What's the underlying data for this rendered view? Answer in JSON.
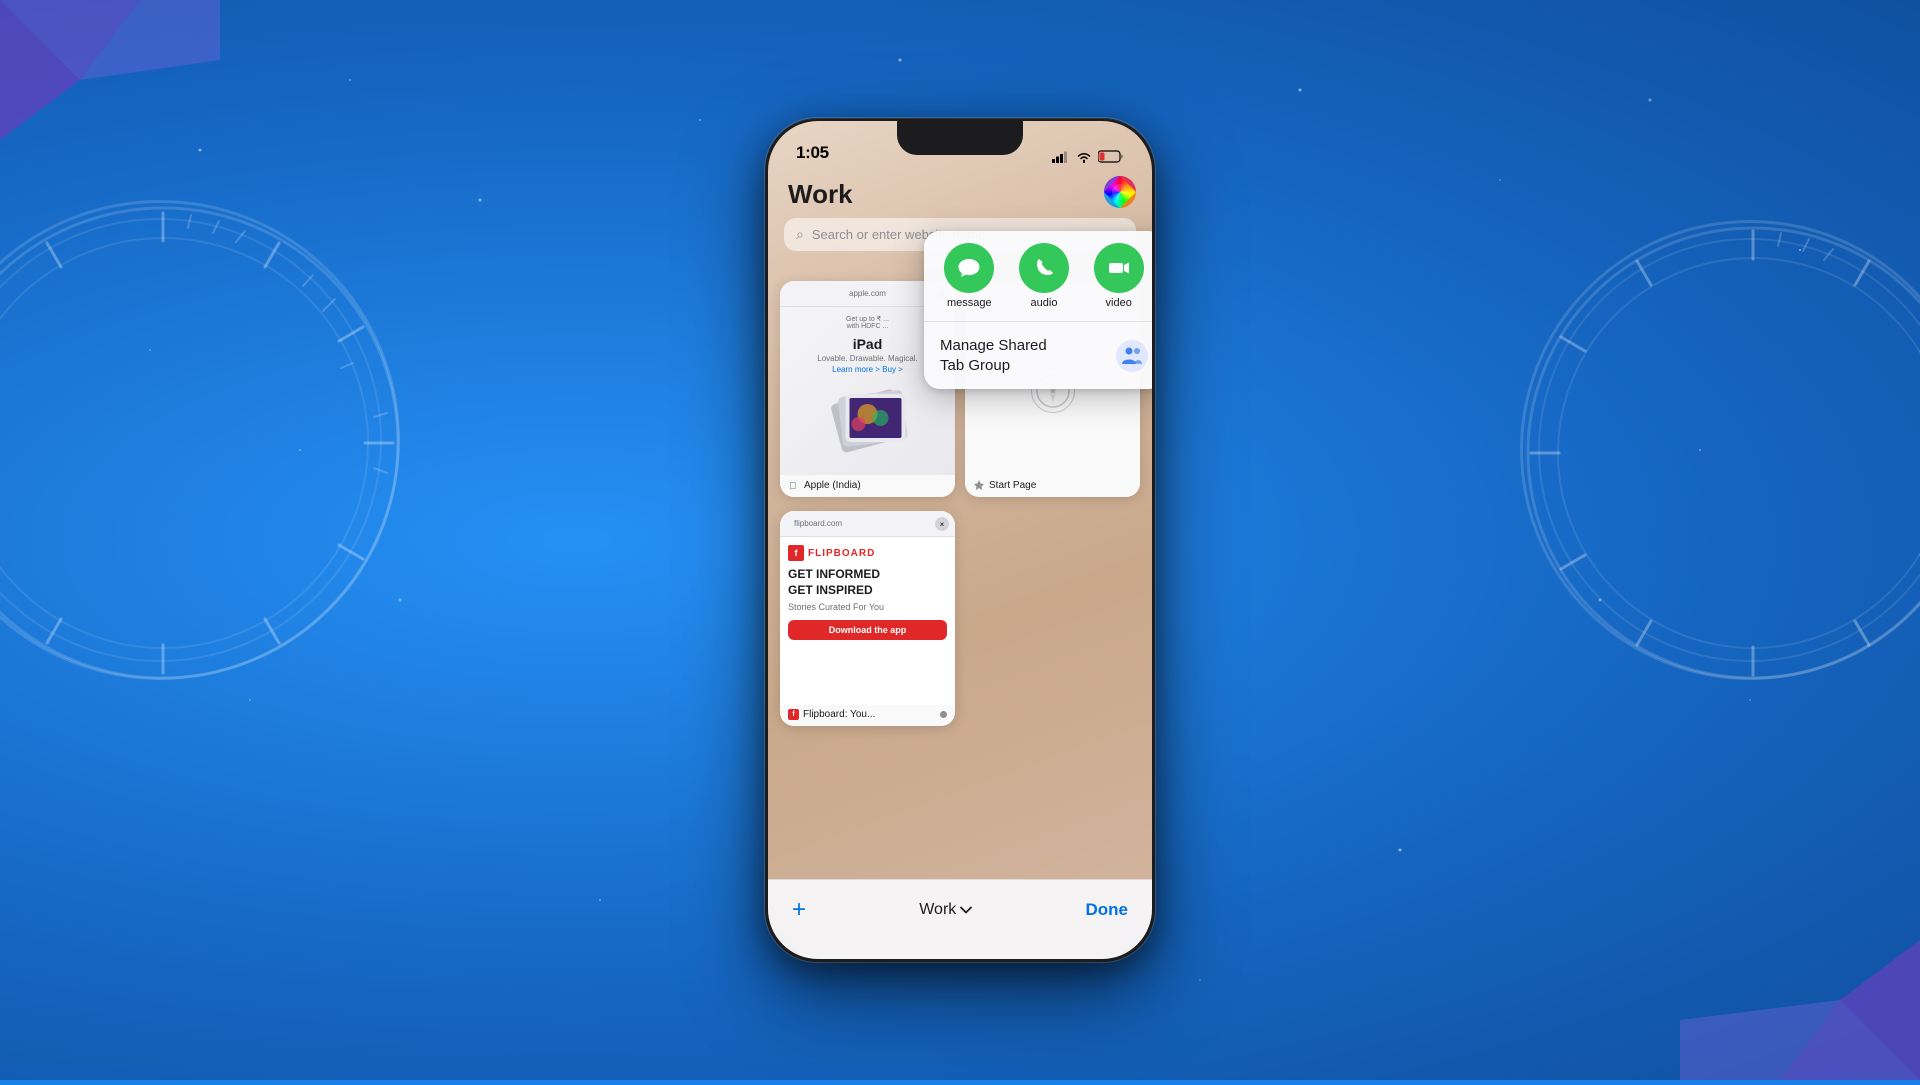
{
  "background": {
    "color": "#1a7fe8"
  },
  "status_bar": {
    "time": "1:05",
    "signal_bars": "●●●●",
    "wifi": "wifi",
    "battery": "battery"
  },
  "safari": {
    "tab_group": "Work",
    "search_placeholder": "Search or enter website name",
    "tabs": [
      {
        "id": "apple-india",
        "url": "apple.com",
        "title": "Apple (India)",
        "favicon": "apple",
        "type": "apple-ad",
        "ad_small": "Get up to ₹ ...\nwith HDFC ...",
        "ad_title": "iPad",
        "ad_subtitle": "Lovable. Drawable. Magical.",
        "ad_links": "Learn more >    Buy >"
      },
      {
        "id": "start-page",
        "url": "Start Page",
        "title": "Start Page",
        "favicon": "star",
        "type": "start-page"
      },
      {
        "id": "flipboard",
        "url": "flipboard.com",
        "title": "Flipboard: You...",
        "favicon": "flipboard",
        "type": "flipboard",
        "headline1": "GET INFORMED",
        "headline2": "GET INSPIRED",
        "subtitle": "Stories Curated For You",
        "btn_label": "Download the app"
      }
    ]
  },
  "popup": {
    "share_options": [
      {
        "id": "message",
        "label": "message",
        "icon": "💬"
      },
      {
        "id": "audio",
        "label": "audio",
        "icon": "📞"
      },
      {
        "id": "video",
        "label": "video",
        "icon": "🎥"
      }
    ],
    "manage_label": "Manage Shared\nTab Group",
    "manage_icon": "👥"
  },
  "toolbar": {
    "plus_label": "+",
    "tab_group_name": "Work",
    "chevron": "∨",
    "done_label": "Done"
  }
}
